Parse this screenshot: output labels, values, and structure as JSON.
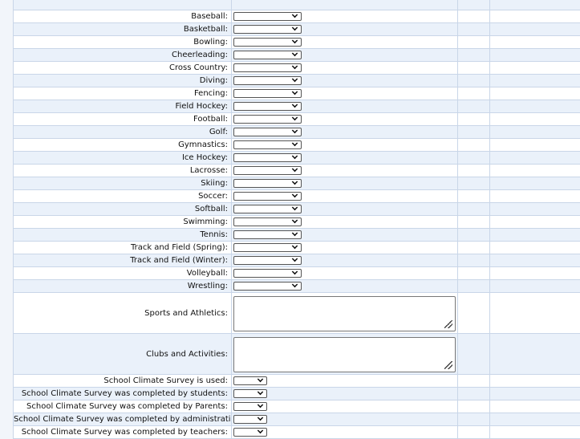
{
  "sports": [
    {
      "label": "Baseball:"
    },
    {
      "label": "Basketball:"
    },
    {
      "label": "Bowling:"
    },
    {
      "label": "Cheerleading:"
    },
    {
      "label": "Cross Country:"
    },
    {
      "label": "Diving:"
    },
    {
      "label": "Fencing:"
    },
    {
      "label": "Field Hockey:"
    },
    {
      "label": "Football:"
    },
    {
      "label": "Golf:"
    },
    {
      "label": "Gymnastics:"
    },
    {
      "label": "Ice Hockey:"
    },
    {
      "label": "Lacrosse:"
    },
    {
      "label": "Skiing:"
    },
    {
      "label": "Soccer:"
    },
    {
      "label": "Softball:"
    },
    {
      "label": "Swimming:"
    },
    {
      "label": "Tennis:"
    },
    {
      "label": "Track and Field (Spring):"
    },
    {
      "label": "Track and Field (Winter):"
    },
    {
      "label": "Volleyball:"
    },
    {
      "label": "Wrestling:"
    }
  ],
  "textareas": [
    {
      "label": "Sports and Athletics:",
      "value": ""
    },
    {
      "label": "Clubs and Activities:",
      "value": ""
    }
  ],
  "climate": [
    {
      "label": "School Climate Survey is used:"
    },
    {
      "label": "School Climate Survey was completed by students:"
    },
    {
      "label": "School Climate Survey was completed by Parents:"
    },
    {
      "label": "School Climate Survey was completed by administration:"
    },
    {
      "label": "School Climate Survey was completed by teachers:"
    }
  ]
}
